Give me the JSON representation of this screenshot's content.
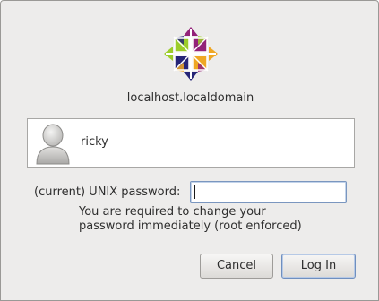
{
  "dialog": {
    "logo_icon": "centos-logo-icon",
    "hostname": "localhost.localdomain"
  },
  "user": {
    "avatar_icon": "user-avatar-icon",
    "name": "ricky"
  },
  "password": {
    "label": "(current) UNIX password:",
    "value": "",
    "message_line1": "You are required to change your",
    "message_line2": "password immediately (root enforced)"
  },
  "buttons": {
    "cancel": "Cancel",
    "login": "Log In"
  }
}
